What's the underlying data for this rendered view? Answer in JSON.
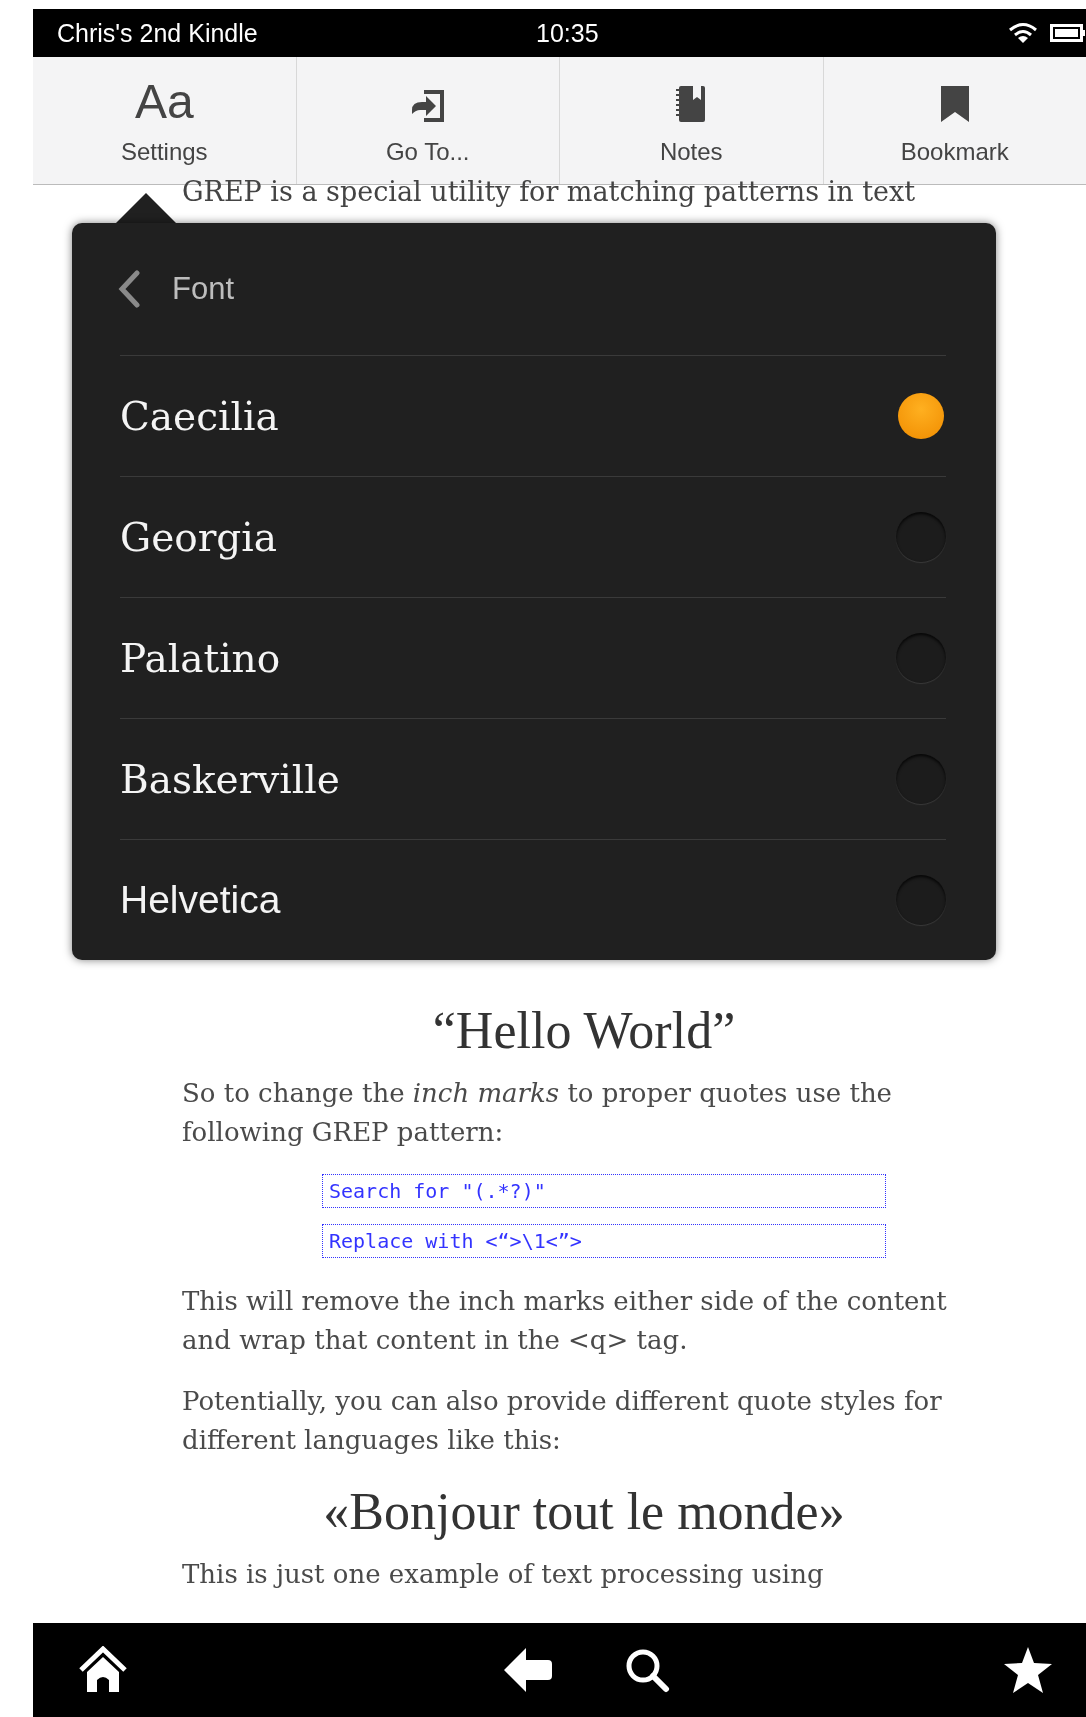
{
  "status_bar": {
    "device_name": "Chris's 2nd Kindle",
    "time": "10:35"
  },
  "toolbar": [
    {
      "kind": "glyph",
      "glyph": "Aa",
      "label": "Settings"
    },
    {
      "kind": "goto",
      "label": "Go To..."
    },
    {
      "kind": "notes",
      "label": "Notes"
    },
    {
      "kind": "bookmark",
      "label": "Bookmark"
    }
  ],
  "book": {
    "partial_line": "GREP is a special utility for matching patterns in text",
    "blocks": [
      {
        "kind": "heading",
        "text": "“Hello World”"
      },
      {
        "kind": "paragraph",
        "text": "So to change the *inch marks* to proper quotes use the following GREP pattern:"
      },
      {
        "kind": "code",
        "text": "Search for \"(.*?)\""
      },
      {
        "kind": "code",
        "text": "Replace with <“>\\1<”>"
      },
      {
        "kind": "paragraph",
        "text": "This will remove the inch marks either side of the content and wrap that content in the <q> tag."
      },
      {
        "kind": "paragraph",
        "text": "Potentially, you can also provide different quote styles for different languages like this:"
      },
      {
        "kind": "heading",
        "text": "«Bonjour tout le monde»"
      },
      {
        "kind": "paragraph",
        "text": "This is just one example of text processing using"
      }
    ]
  },
  "font_menu": {
    "title": "Font",
    "fonts": [
      {
        "name": "Caecilia",
        "kind": "serif",
        "selected": true
      },
      {
        "name": "Georgia",
        "kind": "serif",
        "selected": false
      },
      {
        "name": "Palatino",
        "kind": "serif",
        "selected": false
      },
      {
        "name": "Baskerville",
        "kind": "serif",
        "selected": false
      },
      {
        "name": "Helvetica",
        "kind": "sans",
        "selected": false
      }
    ]
  }
}
